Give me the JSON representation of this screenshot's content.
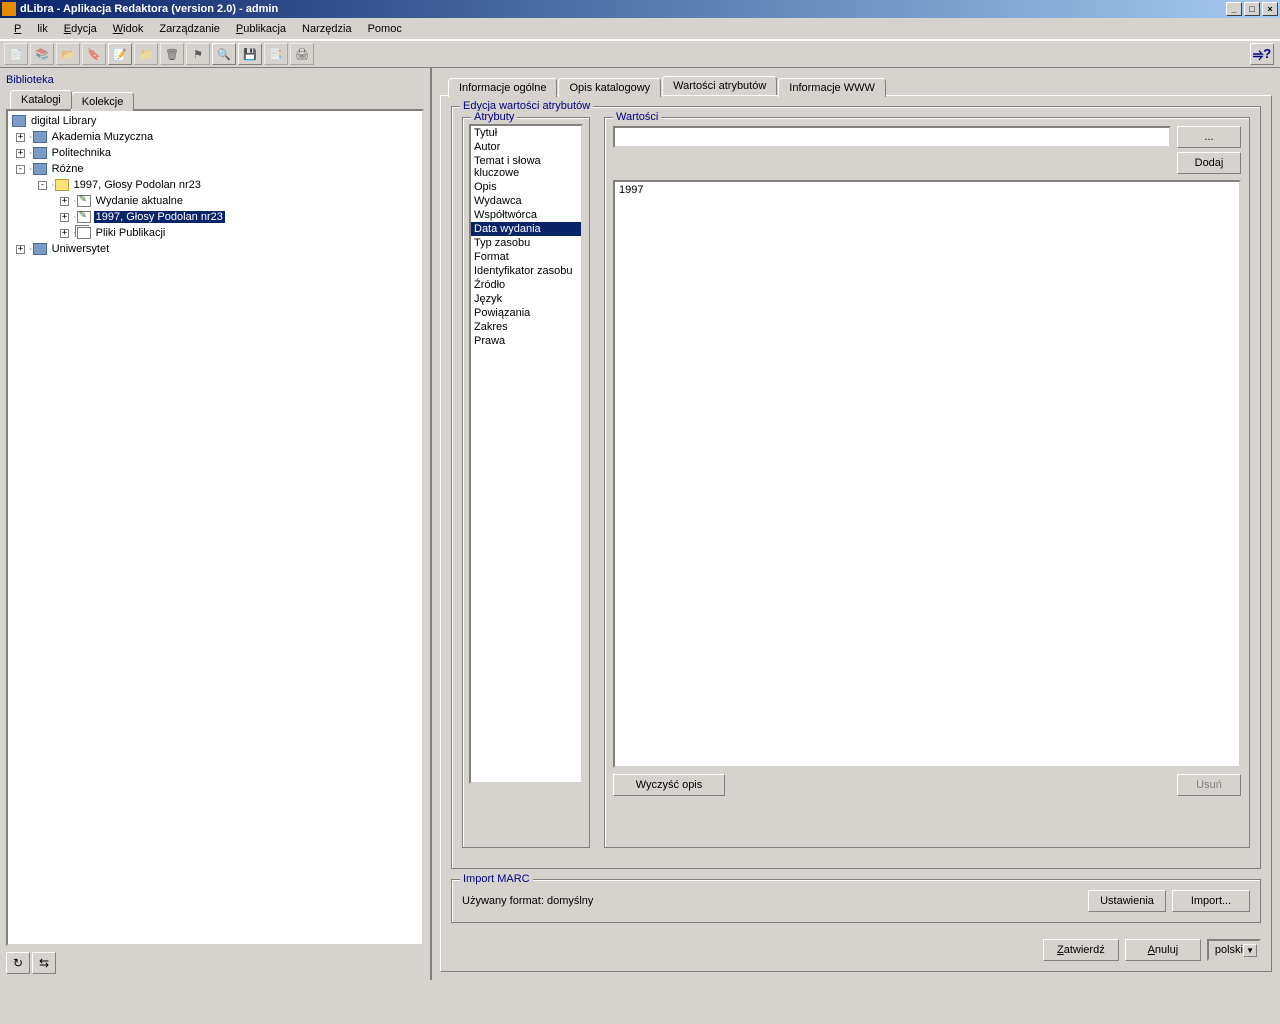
{
  "window": {
    "title": "dLibra - Aplikacja Redaktora (version 2.0) - admin"
  },
  "menus": {
    "file": "Plik",
    "edit": "Edycja",
    "view": "Widok",
    "manage": "Zarządzanie",
    "publication": "Publikacja",
    "tools": "Narzędzia",
    "help": "Pomoc"
  },
  "leftpane": {
    "title": "Biblioteka",
    "tabs": {
      "catalogs": "Katalogi",
      "collections": "Kolekcje"
    },
    "tree": {
      "root": "digital Library",
      "n0": "Akademia Muzyczna",
      "n1": "Politechnika",
      "n2": "Różne",
      "n2_0": "1997, Głosy Podolan nr23",
      "n2_0_0": "Wydanie aktualne",
      "n2_0_1": "1997, Głosy Podolan nr23",
      "n2_0_2": "Pliki Publikacji",
      "n3": "Uniwersytet"
    }
  },
  "rtabs": {
    "t0": "Informacje ogólne",
    "t1": "Opis katalogowy",
    "t2": "Wartości atrybutów",
    "t3": "Informacje WWW"
  },
  "editor": {
    "group_title": "Edycja wartości atrybutów",
    "attrs_title": "Atrybuty",
    "vals_title": "Wartości",
    "attrs": {
      "a0": "Tytuł",
      "a1": "Autor",
      "a2": "Temat i słowa kluczowe",
      "a3": "Opis",
      "a4": "Wydawca",
      "a5": "Współtwórca",
      "a6": "Data wydania",
      "a7": "Typ zasobu",
      "a8": "Format",
      "a9": "Identyfikator zasobu",
      "a10": "Źródło",
      "a11": "Język",
      "a12": "Powiązania",
      "a13": "Zakres",
      "a14": "Prawa"
    },
    "value_input": "",
    "browse_btn": "...",
    "add_btn": "Dodaj",
    "values": {
      "v0": "1997"
    },
    "clear_btn": "Wyczyść opis",
    "delete_btn": "Usuń"
  },
  "marc": {
    "title": "Import MARC",
    "format_label": "Używany format: domyślny",
    "settings_btn": "Ustawienia",
    "import_btn": "Import..."
  },
  "footer": {
    "confirm": "Zatwierdź",
    "cancel": "Anuluj",
    "lang": "polski"
  }
}
